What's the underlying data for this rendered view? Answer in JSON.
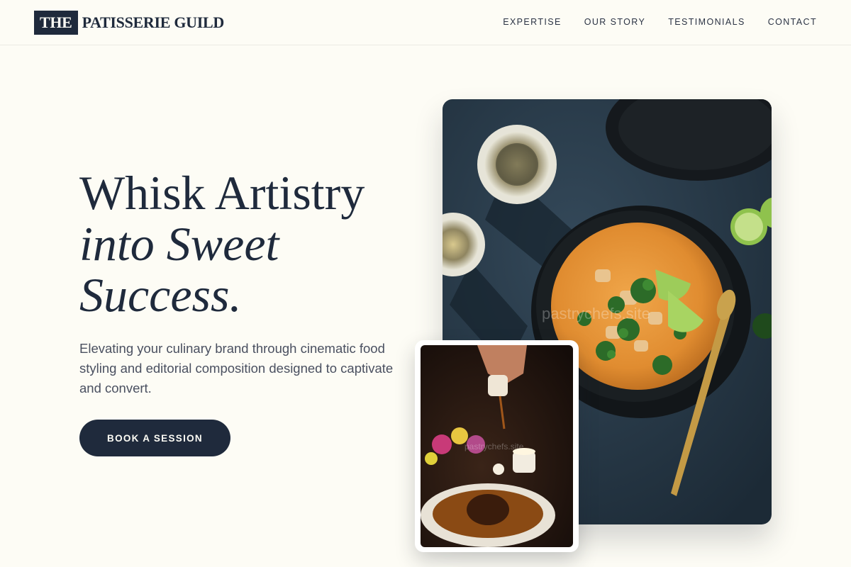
{
  "brand": {
    "logo_box": "THE",
    "logo_text": "PATISSERIE GUILD"
  },
  "nav": {
    "items": [
      "EXPERTISE",
      "OUR STORY",
      "TESTIMONIALS",
      "CONTACT"
    ]
  },
  "hero": {
    "headline_line1": "Whisk Artistry",
    "headline_line2": "into Sweet",
    "headline_line3": "Success.",
    "subtext": "Elevating your culinary brand through cinematic food styling and editorial composition designed to captivate and convert.",
    "cta_label": "BOOK A SESSION"
  },
  "images": {
    "main_watermark": "pastrychefs.site",
    "small_watermark": "pastrychefs.site",
    "main_alt": "Curry bowl with lime and broccoli on dark table",
    "small_alt": "Sauce being poured over plated dish"
  },
  "colors": {
    "background": "#fdfcf5",
    "navy": "#1f2a3c",
    "body_text": "#4a5060"
  }
}
